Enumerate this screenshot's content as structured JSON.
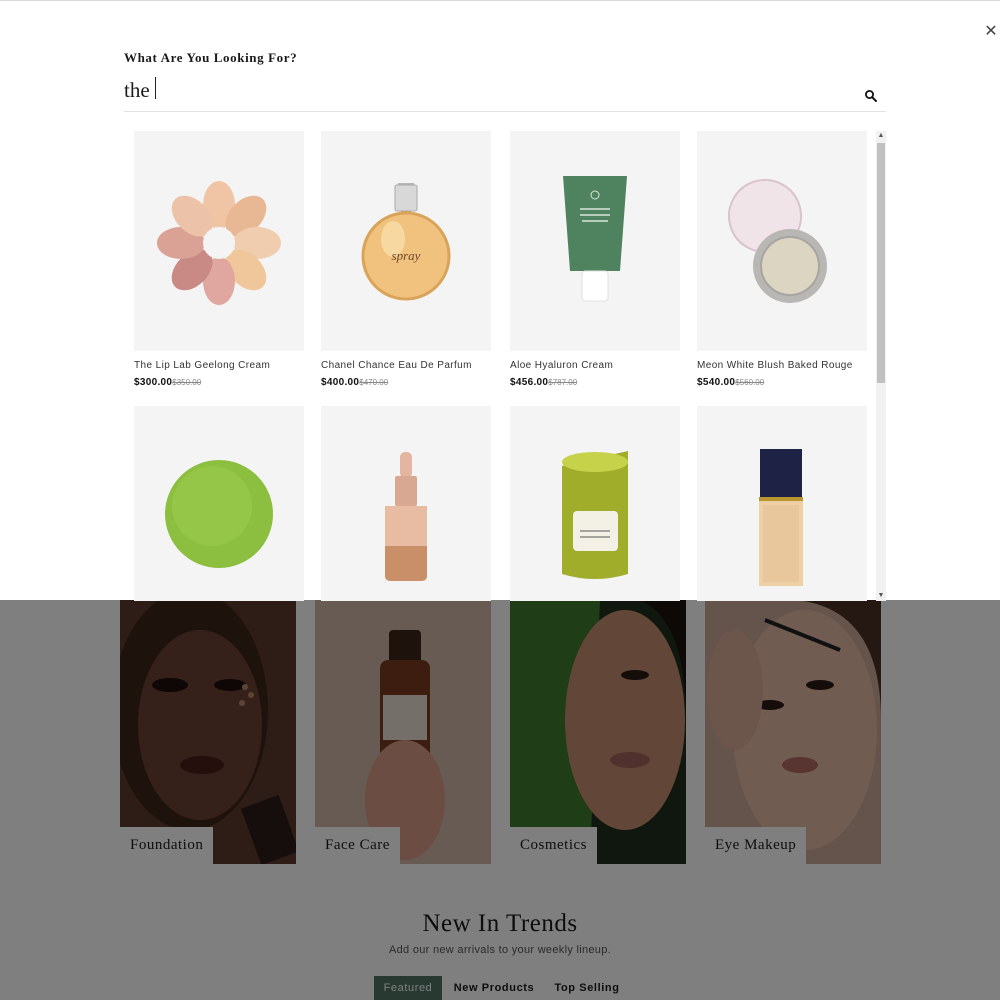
{
  "search": {
    "heading": "What Are You Looking For?",
    "query": "the"
  },
  "results": [
    {
      "name": "The Lip Lab Geelong Cream",
      "price": "$300.00",
      "old_price": "$350.00",
      "image": "flower-petals-swatch"
    },
    {
      "name": "Chanel Chance Eau De Parfum",
      "price": "$400.00",
      "old_price": "$470.00",
      "image": "perfume-bottle"
    },
    {
      "name": "Aloe Hyaluron Cream",
      "price": "$456.00",
      "old_price": "$787.00",
      "image": "green-tube"
    },
    {
      "name": "Meon White Blush Baked Rouge",
      "price": "$540.00",
      "old_price": "$560.00",
      "image": "compact-powder"
    },
    {
      "image": "green-powder"
    },
    {
      "image": "dropper-bottle"
    },
    {
      "image": "candle-jar"
    },
    {
      "image": "foundation-bottle"
    }
  ],
  "bottle_label": "spray",
  "categories": [
    {
      "label": "Foundation"
    },
    {
      "label": "Face Care"
    },
    {
      "label": "Cosmetics"
    },
    {
      "label": "Eye Makeup"
    }
  ],
  "trends": {
    "title": "New In Trends",
    "subtitle": "Add our new arrivals to your weekly lineup.",
    "tabs": [
      "Featured",
      "New Products",
      "Top Selling"
    ]
  },
  "colors": {
    "accent": "#4e7361",
    "overlay": "rgba(0,0,0,0.5)"
  }
}
